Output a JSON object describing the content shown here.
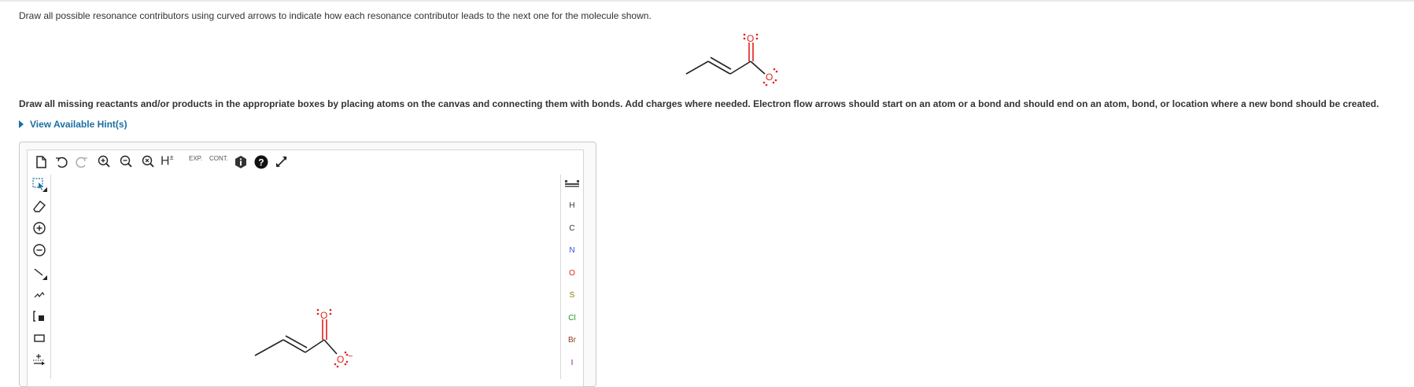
{
  "question": "Draw all possible resonance contributors using curved arrows to indicate how each resonance contributor leads to the next one for the molecule shown.",
  "instructions": "Draw all missing reactants and/or products in the appropriate boxes by placing atoms on the canvas and connecting them with bonds. Add charges where needed. Electron flow arrows should start on an atom or a bond and should end on an atom, bond, or location where a new bond should be created.",
  "hint_link": "View Available Hint(s)",
  "molecule": {
    "oxygen_label": "O",
    "charge": "−"
  },
  "toolbar": {
    "h_label": "H",
    "h_sup": "±",
    "exp_label": "EXP.",
    "cont_label": "CONT."
  },
  "atoms": [
    {
      "label": "H",
      "color": "#333333"
    },
    {
      "label": "C",
      "color": "#333333"
    },
    {
      "label": "N",
      "color": "#2f4fd8"
    },
    {
      "label": "O",
      "color": "#e0201b"
    },
    {
      "label": "S",
      "color": "#8a7b00"
    },
    {
      "label": "Cl",
      "color": "#1a9a1a"
    },
    {
      "label": "Br",
      "color": "#8b3a1a"
    },
    {
      "label": "I",
      "color": "#7a1aa0"
    }
  ],
  "colors": {
    "accent": "#1a6fa3",
    "oxygen": "#e0201b"
  }
}
